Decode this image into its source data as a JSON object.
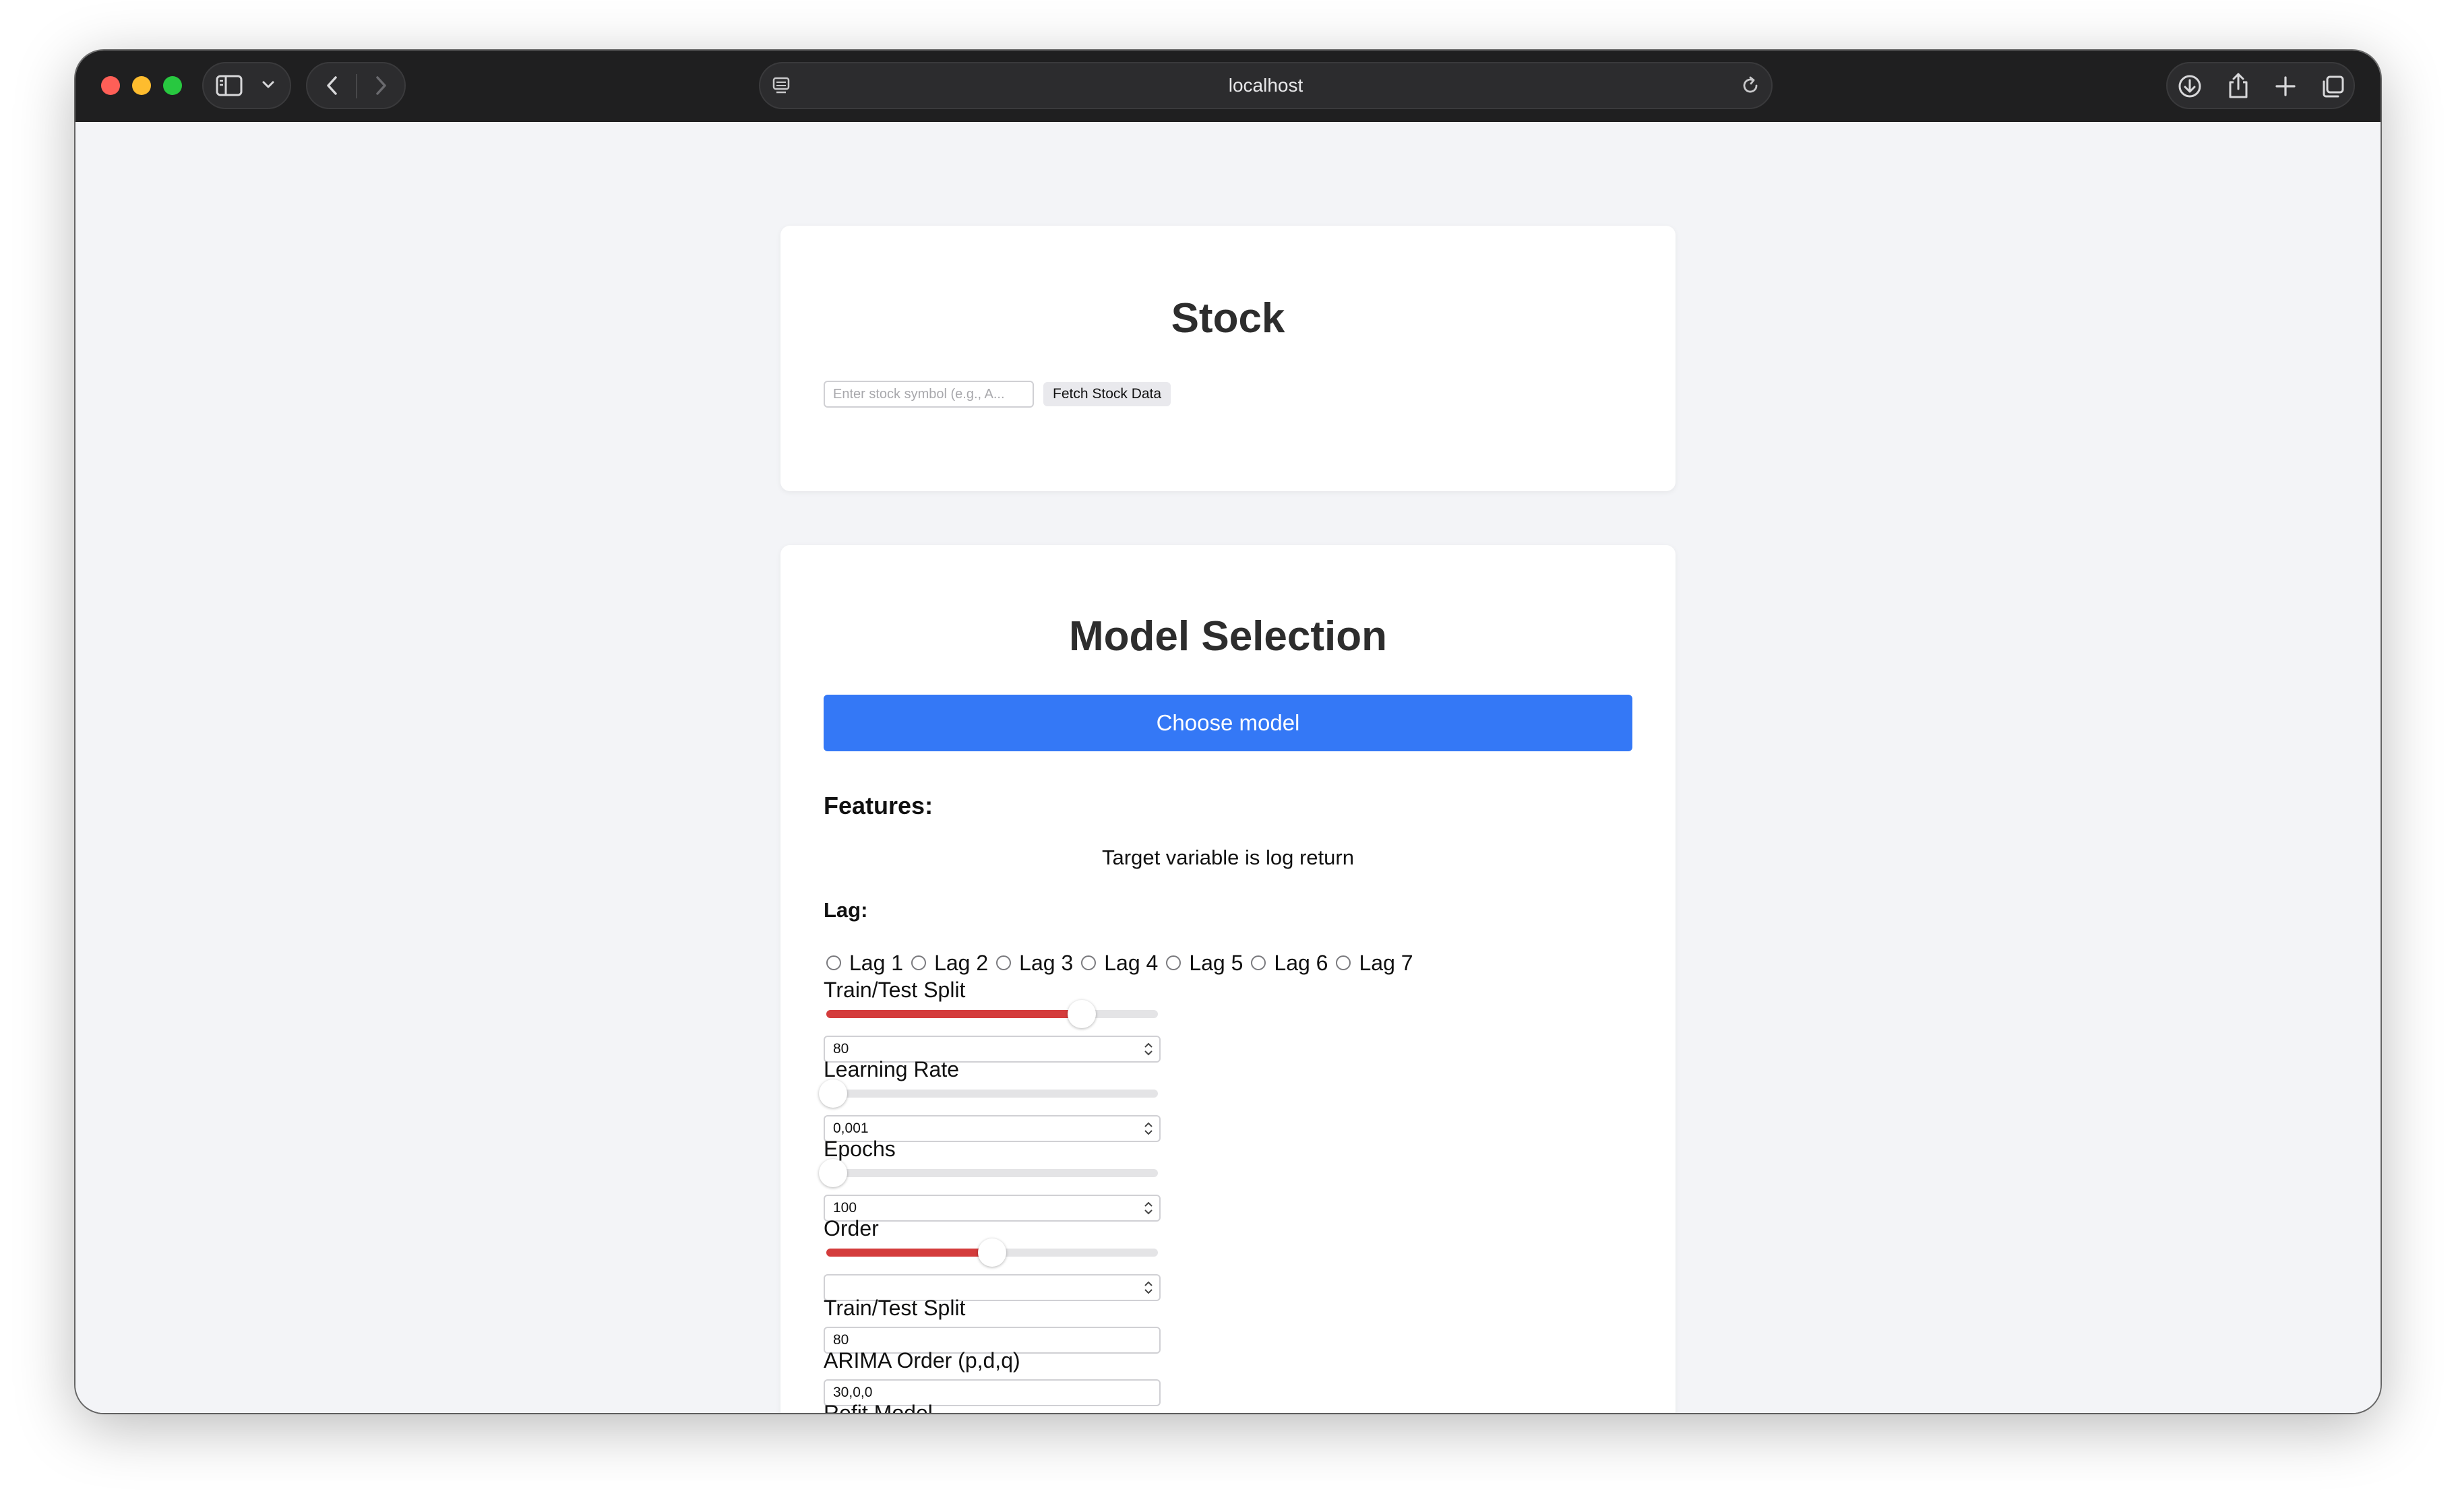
{
  "browser": {
    "address": "localhost"
  },
  "stock_card": {
    "title": "Stock",
    "input_placeholder": "Enter stock symbol (e.g., A...",
    "fetch_button": "Fetch Stock Data"
  },
  "model_card": {
    "title": "Model Selection",
    "choose_button": "Choose model",
    "features_label": "Features:",
    "target_text": "Target variable is log return",
    "lag_label": "Lag:",
    "lags": [
      "Lag 1",
      "Lag 2",
      "Lag 3",
      "Lag 4",
      "Lag 5",
      "Lag 6",
      "Lag 7"
    ],
    "train_test_split": {
      "label": "Train/Test Split",
      "value": "80",
      "slider_fraction": 0.77
    },
    "learning_rate": {
      "label": "Learning Rate",
      "value": "0,001",
      "slider_fraction": 0.02
    },
    "epochs": {
      "label": "Epochs",
      "value": "100",
      "slider_fraction": 0.02
    },
    "order": {
      "label": "Order",
      "value": "",
      "slider_fraction": 0.5
    },
    "train_test_split_2": {
      "label": "Train/Test Split",
      "value": "80"
    },
    "arima_order": {
      "label": "ARIMA Order (p,d,q)",
      "value": "30,0,0"
    },
    "refit_model": {
      "label": "Refit Model",
      "checked": false
    }
  },
  "colors": {
    "primary_button": "#3478f6",
    "slider_fill": "#d43c3c",
    "page_background": "#f3f4f7"
  }
}
